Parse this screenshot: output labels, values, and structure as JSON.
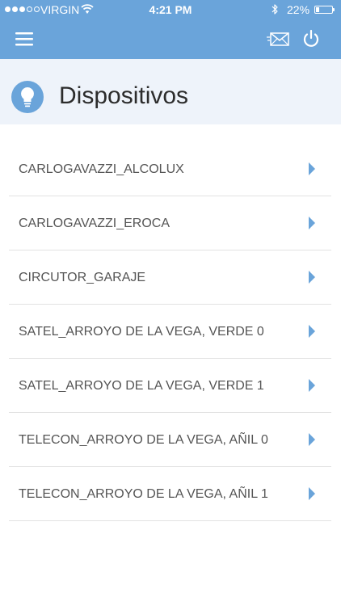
{
  "status_bar": {
    "carrier": "VIRGIN",
    "time": "4:21 PM",
    "battery": "22%",
    "battery_level": 0.22
  },
  "page": {
    "title": "Dispositivos"
  },
  "devices": [
    {
      "name": "CARLOGAVAZZI_ALCOLUX"
    },
    {
      "name": "CARLOGAVAZZI_EROCA"
    },
    {
      "name": "CIRCUTOR_GARAJE"
    },
    {
      "name": "SATEL_ARROYO DE LA VEGA, VERDE 0"
    },
    {
      "name": "SATEL_ARROYO DE LA VEGA, VERDE 1"
    },
    {
      "name": "TELECON_ARROYO DE LA VEGA, AÑIL 0"
    },
    {
      "name": "TELECON_ARROYO DE LA VEGA, AÑIL 1"
    }
  ],
  "icons": {
    "menu": "hamburger-menu-icon",
    "mail": "mail-icon",
    "power": "power-icon",
    "header": "lightbulb-icon",
    "row": "chevron-right-icon"
  },
  "colors": {
    "primary": "#6aa4da",
    "header_background": "#eef3fa",
    "text": "#555555"
  }
}
